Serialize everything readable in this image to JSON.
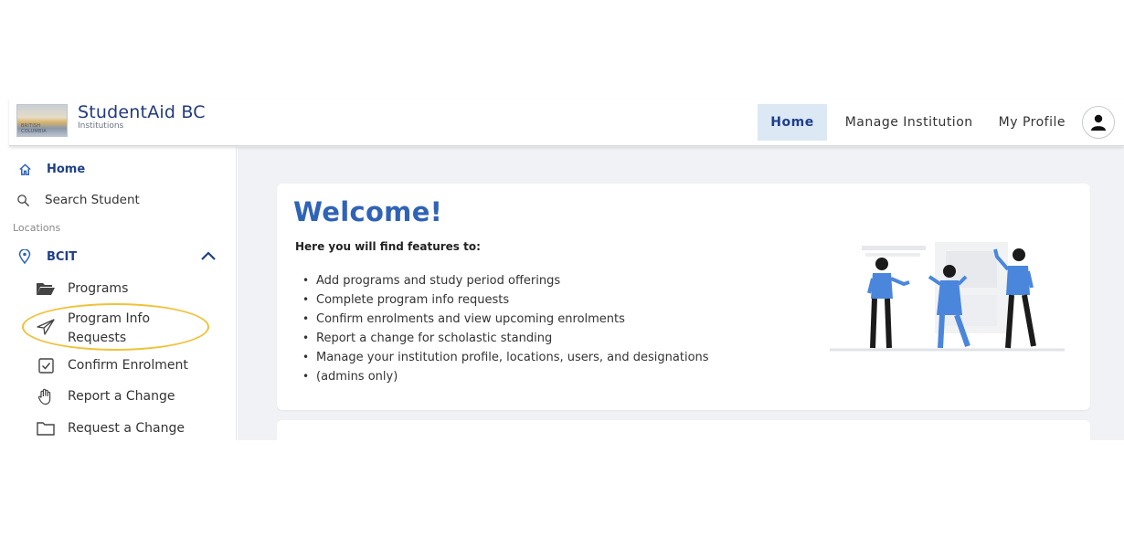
{
  "brand": {
    "title": "StudentAid BC",
    "subtitle": "Institutions",
    "logo_text": "BRITISH COLUMBIA"
  },
  "nav": {
    "items": [
      "Home",
      "Manage Institution",
      "My Profile"
    ],
    "active": "Home",
    "profile_icon": "person-icon"
  },
  "sidebar": {
    "home": "Home",
    "search": "Search Student",
    "section_label": "Locations",
    "location": "BCIT",
    "items": [
      {
        "label": "Programs",
        "icon": "folder-open-icon"
      },
      {
        "label": "Program Info",
        "label2": "Requests",
        "icon": "paper-plane-icon"
      },
      {
        "label": "Confirm Enrolment",
        "icon": "checkbox-icon"
      },
      {
        "label": "Report a Change",
        "icon": "hand-icon"
      },
      {
        "label": "Request a Change",
        "icon": "folder-icon"
      }
    ]
  },
  "main": {
    "welcome": "Welcome!",
    "intro": "Here you will find features to:",
    "features": [
      "Add programs and study period offerings",
      "Complete program info requests",
      "Confirm enrolments and view upcoming enrolments",
      "Report a change for scholastic standing",
      "Manage your institution profile, locations, users, and designations",
      "(admins only)"
    ]
  },
  "colors": {
    "accent": "#2f63b6",
    "brand": "#223b7a",
    "highlight": "#f0c23a",
    "nav_active_bg": "#dde8f5"
  }
}
